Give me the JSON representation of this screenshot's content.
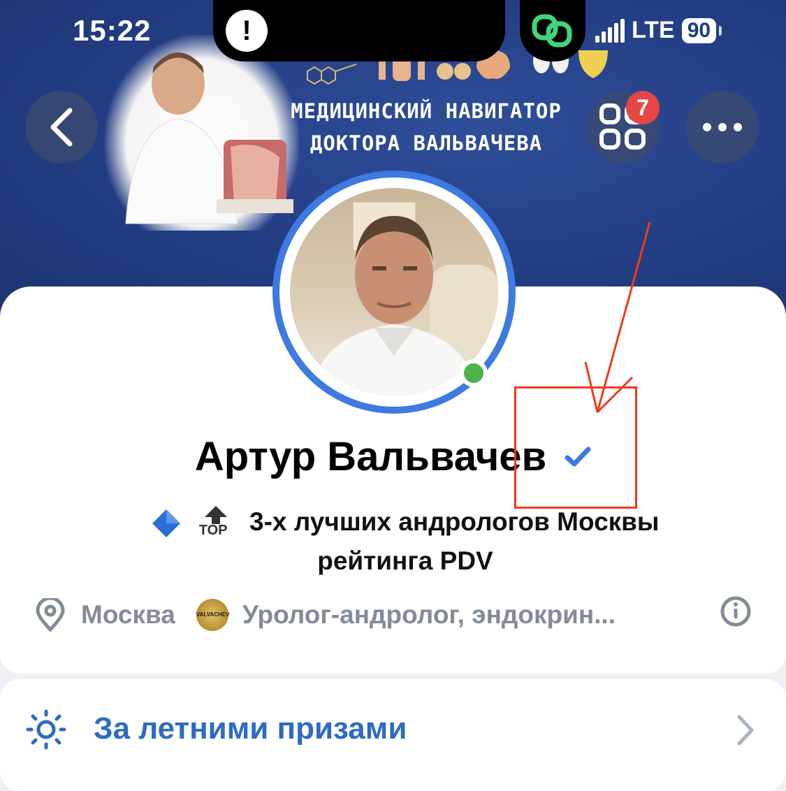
{
  "status_bar": {
    "time": "15:22",
    "alert": "!",
    "network": "LTE",
    "battery": "90"
  },
  "cover": {
    "title_line1": "МЕДИЦИНСКИЙ НАВИГАТОР",
    "title_line2": "ДОКТОРА ВАЛЬВАЧЕВА",
    "apps_badge": "7"
  },
  "profile": {
    "name": "Артур Вальвачев",
    "status_top_label": "TOP",
    "status_text": "3-х лучших андрологов Москвы рейтинга PDV",
    "city": "Москва",
    "logo_text": "VALVACHEV",
    "profession": "Уролог-андролог, эндокрин..."
  },
  "promo": {
    "label": "За летними призами"
  },
  "colors": {
    "cover_bg": "#243f86",
    "accent": "#3d7ae2",
    "online": "#4bb34b",
    "badge": "#e64646",
    "annotation": "#ee3b1c",
    "link": "#2d6bc4",
    "muted": "#818c99"
  }
}
